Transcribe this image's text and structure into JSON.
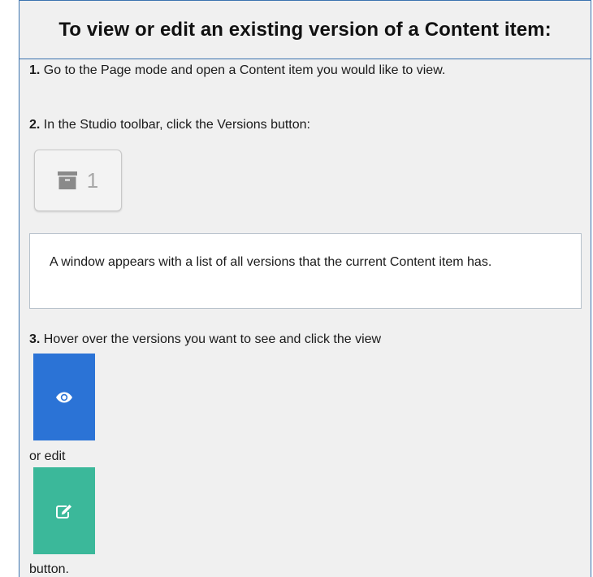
{
  "panel": {
    "title": "To view or edit an existing version of a Content item:"
  },
  "steps": {
    "step1_number": "1.",
    "step1_text": " Go to the Page mode and open a Content item you would like to view.",
    "step2_number": "2.",
    "step2_text": " In the Studio toolbar, click the Versions button:",
    "step3_number": "3.",
    "step3_text": " Hover over the versions you want to see and click the view",
    "or_edit": "or edit",
    "button_end": "button."
  },
  "versions_button": {
    "icon": "archive-icon",
    "count": "1"
  },
  "note": {
    "text": "A window appears with a list of all versions that the current Content item has."
  },
  "view_button": {
    "icon": "eye-icon",
    "color": "#2b73d6"
  },
  "edit_button": {
    "icon": "edit-icon",
    "color": "#3bb89a"
  }
}
